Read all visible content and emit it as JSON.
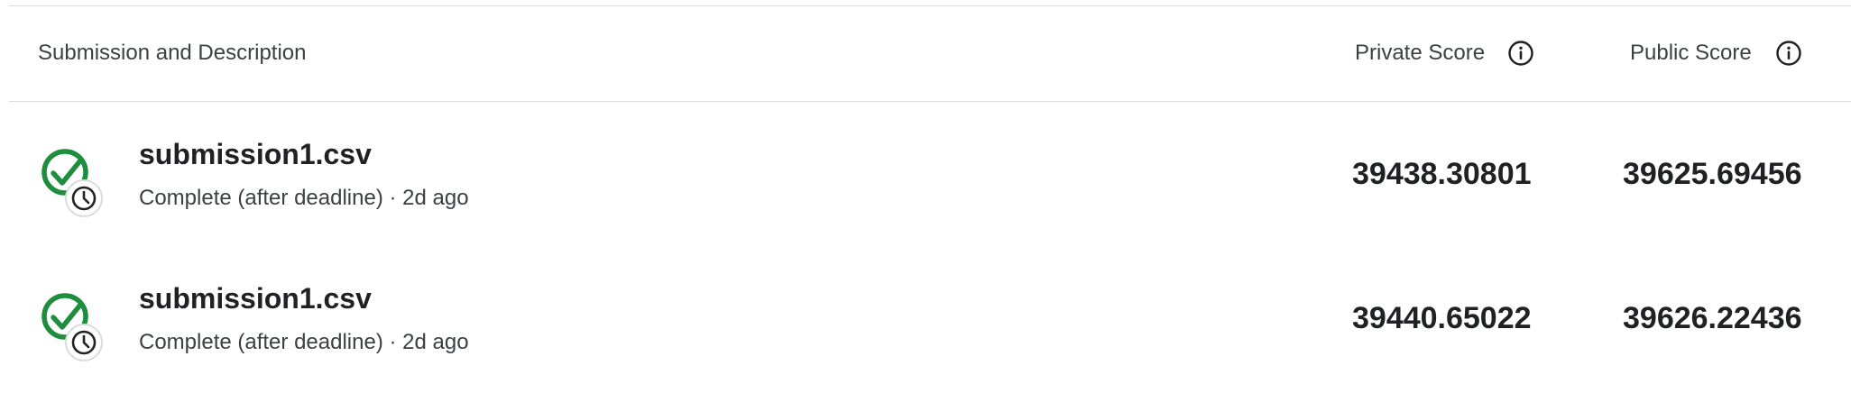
{
  "table": {
    "headers": {
      "submission_description": "Submission and Description",
      "private_score": "Private Score",
      "public_score": "Public Score",
      "info_icon": "info-icon"
    },
    "rows": [
      {
        "file_name": "submission1.csv",
        "status": "Complete (after deadline)",
        "separator": "·",
        "age": "2d ago",
        "meta": "Complete (after deadline) · 2d ago",
        "private_score": "39438.30801",
        "public_score": "39625.69456",
        "status_icon": "check-circle-clock-icon"
      },
      {
        "file_name": "submission1.csv",
        "status": "Complete (after deadline)",
        "separator": "·",
        "age": "2d ago",
        "meta": "Complete (after deadline) · 2d ago",
        "private_score": "39440.65022",
        "public_score": "39626.22436",
        "status_icon": "check-circle-clock-icon"
      }
    ]
  },
  "colors": {
    "success_green": "#1e8e3e",
    "divider": "#dadce0",
    "text_primary": "#202124",
    "text_secondary": "#3c4043"
  }
}
